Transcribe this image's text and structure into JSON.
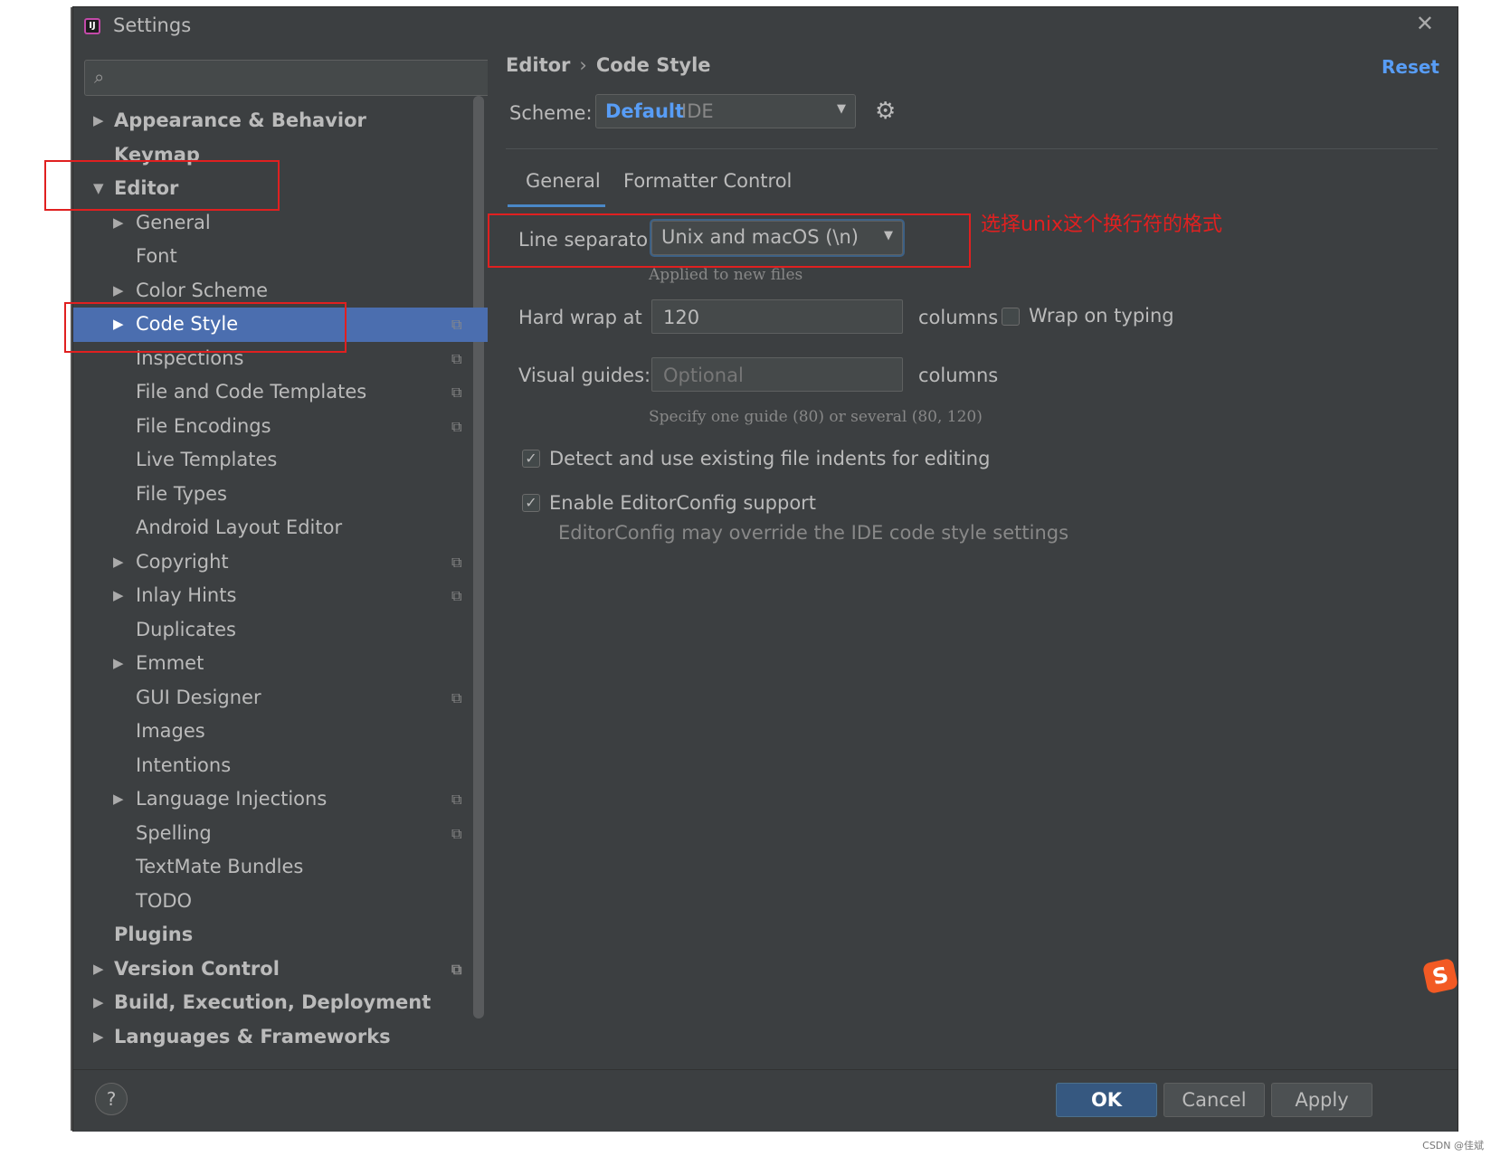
{
  "window": {
    "title": "Settings"
  },
  "search": {
    "placeholder": ""
  },
  "tree": [
    {
      "label": "Appearance & Behavior",
      "level": 0,
      "arrow": "▶",
      "bold": true,
      "copy": false
    },
    {
      "label": "Keymap",
      "level": 0,
      "arrow": "",
      "bold": true,
      "copy": false
    },
    {
      "label": "Editor",
      "level": 0,
      "arrow": "▼",
      "bold": true,
      "copy": false
    },
    {
      "label": "General",
      "level": 1,
      "arrow": "▶",
      "bold": false,
      "copy": false
    },
    {
      "label": "Font",
      "level": 1,
      "arrow": "",
      "bold": false,
      "copy": false
    },
    {
      "label": "Color Scheme",
      "level": 1,
      "arrow": "▶",
      "bold": false,
      "copy": false
    },
    {
      "label": "Code Style",
      "level": 1,
      "arrow": "▶",
      "bold": false,
      "copy": true,
      "selected": true
    },
    {
      "label": "Inspections",
      "level": 1,
      "arrow": "",
      "bold": false,
      "copy": true
    },
    {
      "label": "File and Code Templates",
      "level": 1,
      "arrow": "",
      "bold": false,
      "copy": true
    },
    {
      "label": "File Encodings",
      "level": 1,
      "arrow": "",
      "bold": false,
      "copy": true
    },
    {
      "label": "Live Templates",
      "level": 1,
      "arrow": "",
      "bold": false,
      "copy": false
    },
    {
      "label": "File Types",
      "level": 1,
      "arrow": "",
      "bold": false,
      "copy": false
    },
    {
      "label": "Android Layout Editor",
      "level": 1,
      "arrow": "",
      "bold": false,
      "copy": false
    },
    {
      "label": "Copyright",
      "level": 1,
      "arrow": "▶",
      "bold": false,
      "copy": true
    },
    {
      "label": "Inlay Hints",
      "level": 1,
      "arrow": "▶",
      "bold": false,
      "copy": true
    },
    {
      "label": "Duplicates",
      "level": 1,
      "arrow": "",
      "bold": false,
      "copy": false
    },
    {
      "label": "Emmet",
      "level": 1,
      "arrow": "▶",
      "bold": false,
      "copy": false
    },
    {
      "label": "GUI Designer",
      "level": 1,
      "arrow": "",
      "bold": false,
      "copy": true
    },
    {
      "label": "Images",
      "level": 1,
      "arrow": "",
      "bold": false,
      "copy": false
    },
    {
      "label": "Intentions",
      "level": 1,
      "arrow": "",
      "bold": false,
      "copy": false
    },
    {
      "label": "Language Injections",
      "level": 1,
      "arrow": "▶",
      "bold": false,
      "copy": true
    },
    {
      "label": "Spelling",
      "level": 1,
      "arrow": "",
      "bold": false,
      "copy": true
    },
    {
      "label": "TextMate Bundles",
      "level": 1,
      "arrow": "",
      "bold": false,
      "copy": false
    },
    {
      "label": "TODO",
      "level": 1,
      "arrow": "",
      "bold": false,
      "copy": false
    },
    {
      "label": "Plugins",
      "level": 0,
      "arrow": "",
      "bold": true,
      "copy": false
    },
    {
      "label": "Version Control",
      "level": 0,
      "arrow": "▶",
      "bold": true,
      "copy": true
    },
    {
      "label": "Build, Execution, Deployment",
      "level": 0,
      "arrow": "▶",
      "bold": true,
      "copy": false
    },
    {
      "label": "Languages & Frameworks",
      "level": 0,
      "arrow": "▶",
      "bold": true,
      "copy": false
    }
  ],
  "breadcrumb": {
    "parent": "Editor",
    "separator": "›",
    "current": "Code Style"
  },
  "reset_label": "Reset",
  "scheme": {
    "label": "Scheme:",
    "name": "Default",
    "kind": "IDE"
  },
  "tabs": {
    "general": "General",
    "formatter": "Formatter Control"
  },
  "line_separator": {
    "label": "Line separator:",
    "value": "Unix and macOS (\\n)",
    "hint": "Applied to new files"
  },
  "hard_wrap": {
    "label": "Hard wrap at",
    "value": "120",
    "unit": "columns"
  },
  "wrap_on_typing": {
    "label": "Wrap on typing",
    "checked": false
  },
  "visual_guides": {
    "label": "Visual guides:",
    "placeholder": "Optional",
    "unit": "columns",
    "hint": "Specify one guide (80) or several (80, 120)"
  },
  "detect_indents": {
    "label": "Detect and use existing file indents for editing",
    "checked": true
  },
  "editorconfig": {
    "label": "Enable EditorConfig support",
    "checked": true,
    "hint": "EditorConfig may override the IDE code style settings"
  },
  "annotation": {
    "text": "选择unix这个换行符的格式",
    "color": "#e02020"
  },
  "footer": {
    "help": "?",
    "ok": "OK",
    "cancel": "Cancel",
    "apply": "Apply"
  },
  "watermark": "CSDN @佳斌",
  "colors": {
    "selection": "#4b6eaf",
    "link": "#589df6",
    "background": "#3c3f41",
    "primary_button": "#365880"
  }
}
